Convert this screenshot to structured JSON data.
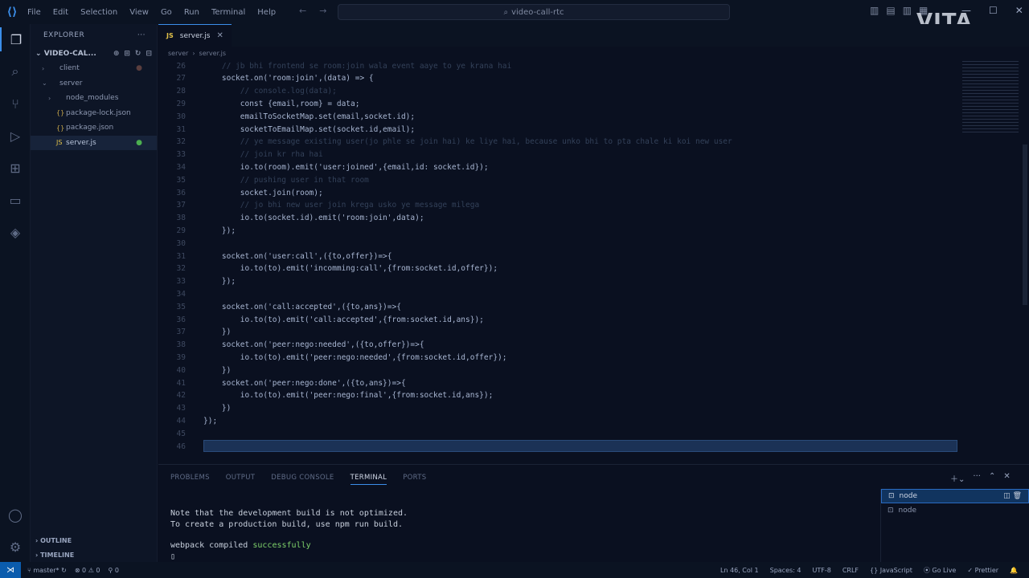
{
  "window": {
    "search": "video-call-rtc",
    "watermark": "VITA"
  },
  "menu": [
    "File",
    "Edit",
    "Selection",
    "View",
    "Go",
    "Run",
    "Terminal",
    "Help"
  ],
  "explorer": {
    "title": "EXPLORER",
    "folder": "VIDEO-CAL...",
    "items": [
      {
        "label": "client",
        "depth": 0,
        "kind": "folder",
        "open": false
      },
      {
        "label": "server",
        "depth": 0,
        "kind": "folder",
        "open": true
      },
      {
        "label": "node_modules",
        "depth": 1,
        "kind": "folder",
        "open": false
      },
      {
        "label": "package-lock.json",
        "depth": 1,
        "kind": "json"
      },
      {
        "label": "package.json",
        "depth": 1,
        "kind": "json"
      },
      {
        "label": "server.js",
        "depth": 1,
        "kind": "js",
        "selected": true
      }
    ],
    "outline": "OUTLINE",
    "timeline": "TIMELINE"
  },
  "editor": {
    "tab": "server.js",
    "breadcrumb": [
      "server",
      "server.js"
    ],
    "lines": [
      {
        "n": "26",
        "t": "    // jb bhi frontend se room:join wala event aaye to ye krana hai",
        "c": true
      },
      {
        "n": "27",
        "t": "    socket.on('room:join',(data) => {"
      },
      {
        "n": "28",
        "t": "        // console.log(data);",
        "c": true
      },
      {
        "n": "29",
        "t": "        const {email,room} = data;"
      },
      {
        "n": "30",
        "t": "        emailToSocketMap.set(email,socket.id);"
      },
      {
        "n": "31",
        "t": "        socketToEmailMap.set(socket.id,email);"
      },
      {
        "n": "32",
        "t": "        // ye message existing user(jo phle se join hai) ke liye hai, because unko bhi to pta chale ki koi new user",
        "c": true
      },
      {
        "n": "33",
        "t": "        // join kr rha hai",
        "c": true
      },
      {
        "n": "34",
        "t": "        io.to(room).emit('user:joined',{email,id: socket.id});"
      },
      {
        "n": "35",
        "t": "        // pushing user in that room",
        "c": true
      },
      {
        "n": "36",
        "t": "        socket.join(room);"
      },
      {
        "n": "37",
        "t": "        // jo bhi new user join krega usko ye message milega",
        "c": true
      },
      {
        "n": "38",
        "t": "        io.to(socket.id).emit('room:join',data);"
      },
      {
        "n": "29",
        "t": "    });"
      },
      {
        "n": "30",
        "t": ""
      },
      {
        "n": "31",
        "t": "    socket.on('user:call',({to,offer})=>{"
      },
      {
        "n": "32",
        "t": "        io.to(to).emit('incomming:call',{from:socket.id,offer});"
      },
      {
        "n": "33",
        "t": "    });"
      },
      {
        "n": "34",
        "t": ""
      },
      {
        "n": "35",
        "t": "    socket.on('call:accepted',({to,ans})=>{"
      },
      {
        "n": "36",
        "t": "        io.to(to).emit('call:accepted',{from:socket.id,ans});"
      },
      {
        "n": "37",
        "t": "    })"
      },
      {
        "n": "38",
        "t": "    socket.on('peer:nego:needed',({to,offer})=>{"
      },
      {
        "n": "39",
        "t": "        io.to(to).emit('peer:nego:needed',{from:socket.id,offer});"
      },
      {
        "n": "40",
        "t": "    })"
      },
      {
        "n": "41",
        "t": "    socket.on('peer:nego:done',({to,ans})=>{"
      },
      {
        "n": "42",
        "t": "        io.to(to).emit('peer:nego:final',{from:socket.id,ans});"
      },
      {
        "n": "43",
        "t": "    })"
      },
      {
        "n": "44",
        "t": "});"
      },
      {
        "n": "45",
        "t": ""
      },
      {
        "n": "46",
        "t": ""
      }
    ]
  },
  "panel": {
    "tabs": [
      "PROBLEMS",
      "OUTPUT",
      "DEBUG CONSOLE",
      "TERMINAL",
      "PORTS"
    ],
    "active_tab": "TERMINAL",
    "terminal": {
      "line1": "Note that the development build is not optimized.",
      "line2": "To create a production build, use npm run build.",
      "line3_prefix": "webpack compiled ",
      "line3_ok": "successfully",
      "prompt": "▯"
    },
    "terminals": [
      "node",
      "node"
    ]
  },
  "status": {
    "branch": "master*",
    "errors": "⊗ 0 ⚠ 0",
    "ports": "⚲ 0",
    "position": "Ln 46, Col 1",
    "spaces": "Spaces: 4",
    "encoding": "UTF-8",
    "eol": "CRLF",
    "language": "{} JavaScript",
    "golive": "⦿ Go Live",
    "prettier": "✓ Prettier"
  }
}
